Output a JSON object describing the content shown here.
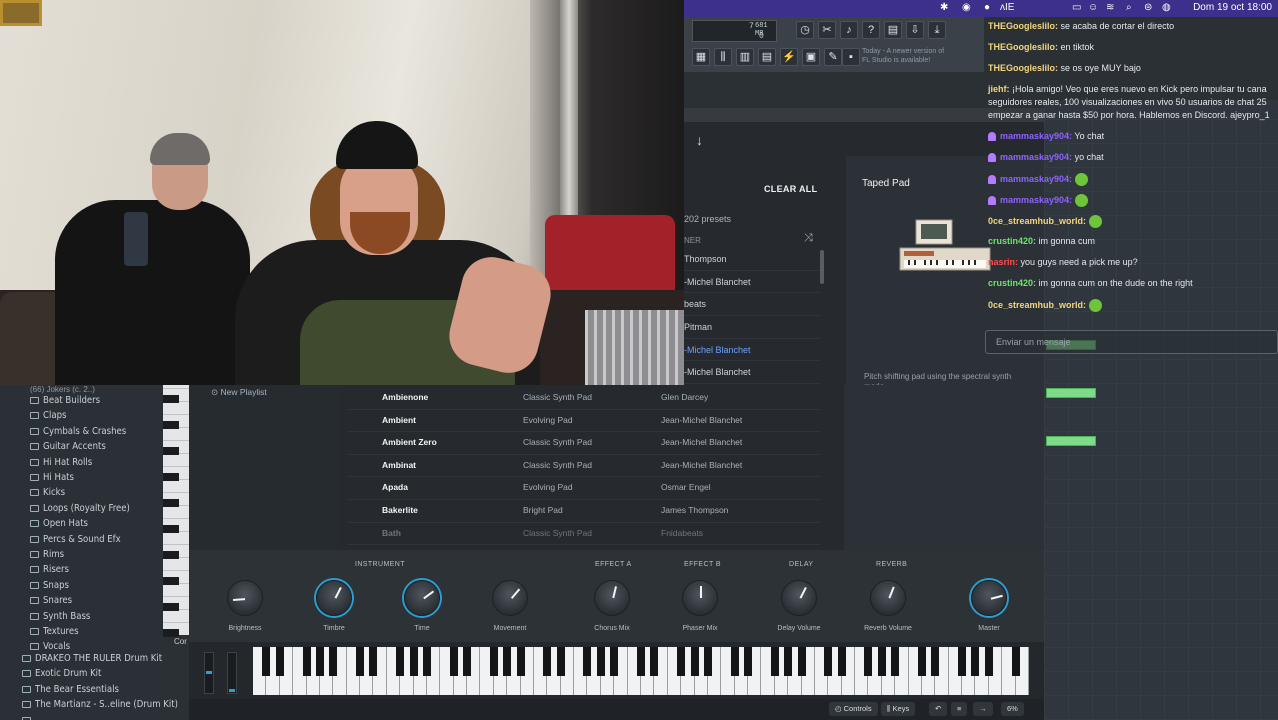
{
  "menubar": {
    "clock": "Dom 19 oct 18:00",
    "partial_label": "ʌIE"
  },
  "fl_toolbar": {
    "lcd_top": "7",
    "lcd_mem": "681 MB",
    "lcd_bottom": "0",
    "news": "Today - A newer version of FL Studio is available!"
  },
  "chat": {
    "messages": [
      {
        "user": "THEGoogleslilo:",
        "text": " se acaba de cortar el directo",
        "style": "user"
      },
      {
        "user": "THEGoogleslilo:",
        "text": " en tiktok",
        "style": "user"
      },
      {
        "user": "THEGoogleslilo:",
        "text": " se os oye MUY bajo",
        "style": "user"
      },
      {
        "user": "jiehf:",
        "text": " ¡Hola amigo! Veo que eres nuevo en Kick pero impulsar tu cana",
        "style": "user"
      },
      {
        "user": "",
        "text": "seguidores reales, 100 visualizaciones en vivo 50 usuarios de chat 25",
        "style": "user"
      },
      {
        "user": "",
        "text": "empezar a ganar hasta $50 por hora. Hablemos en Discord. ajeypro_1",
        "style": "user"
      },
      {
        "user": "mammaskay904:",
        "text": " Yo chat",
        "style": "purple"
      },
      {
        "user": "mammaskay904:",
        "text": " yo chat",
        "style": "purple"
      },
      {
        "user": "mammaskay904:",
        "text": " ",
        "style": "purple"
      },
      {
        "user": "mammaskay904:",
        "text": " ",
        "style": "purple"
      },
      {
        "user": "0ce_streamhub_world:",
        "text": " ",
        "style": "user"
      },
      {
        "user": "crustin420:",
        "text": " im gonna cum",
        "style": "green"
      },
      {
        "user": "nasrin:",
        "text": " you guys need a pick me up?",
        "style": "red"
      },
      {
        "user": "crustin420:",
        "text": " im gonna cum on the dude on the right",
        "style": "green"
      },
      {
        "user": "0ce_streamhub_world:",
        "text": " ",
        "style": "user"
      }
    ],
    "input_placeholder": "Enviar un mensaje"
  },
  "plugin": {
    "clear_all": "CLEAR ALL",
    "preset_count": "202 presets",
    "col_designer": "NER",
    "designers": [
      "Thompson",
      "-Michel Blanchet",
      "beats",
      "Pitman",
      "-Michel Blanchet",
      "-Michel Blanchet"
    ],
    "preset_title": "Taped Pad",
    "preset_desc": "Pitch shifting pad using the spectral synth mode."
  },
  "browser": {
    "truncated_top": "(66) Jokers   (c. 2..)",
    "items": [
      "Beat Builders",
      "Claps",
      "Cymbals & Crashes",
      "Guitar Accents",
      "Hi Hat Rolls",
      "Hi Hats",
      "Kicks",
      "Loops (Royalty Free)",
      "Open Hats",
      "Percs & Sound Efx",
      "Rims",
      "Risers",
      "Snaps",
      "Snares",
      "Synth Bass",
      "Textures",
      "Vocals"
    ],
    "top_items": [
      "DRAKEO THE RULER Drum Kit",
      "Exotic Drum Kit",
      "The Bear Essentials",
      "The Martianz - S..eline (Drum Kit)",
      "..."
    ],
    "cor_label": "Cor"
  },
  "playlist": {
    "new_playlist": "New Playlist"
  },
  "preset_table": [
    {
      "name": "Ambienone",
      "type": "Classic Synth Pad",
      "designer": "Glen Darcey"
    },
    {
      "name": "Ambient",
      "type": "Evolving Pad",
      "designer": "Jean-Michel Blanchet"
    },
    {
      "name": "Ambient Zero",
      "type": "Classic Synth Pad",
      "designer": "Jean-Michel Blanchet"
    },
    {
      "name": "Ambinat",
      "type": "Classic Synth Pad",
      "designer": "Jean-Michel Blanchet"
    },
    {
      "name": "Apada",
      "type": "Evolving Pad",
      "designer": "Osmar Engel"
    },
    {
      "name": "Bakerlite",
      "type": "Bright Pad",
      "designer": "James Thompson"
    },
    {
      "name": "Bath",
      "type": "Classic Synth Pad",
      "designer": "Fnidabeats"
    }
  ],
  "knob_sections": {
    "instrument": "INSTRUMENT",
    "effect_a": "EFFECT A",
    "effect_b": "EFFECT B",
    "delay": "DELAY",
    "reverb": "REVERB"
  },
  "knobs": [
    {
      "label": "Brightness",
      "value": 0.15,
      "accent": false
    },
    {
      "label": "Timbre",
      "value": 0.6,
      "accent": true
    },
    {
      "label": "Time",
      "value": 0.7,
      "accent": true
    },
    {
      "label": "Movement",
      "value": 0.65,
      "accent": false
    },
    {
      "label": "Chorus Mix",
      "value": 0.55,
      "accent": false
    },
    {
      "label": "Phaser Mix",
      "value": 0.5,
      "accent": false
    },
    {
      "label": "Delay Volume",
      "value": 0.6,
      "accent": false
    },
    {
      "label": "Reverb Volume",
      "value": 0.58,
      "accent": false
    },
    {
      "label": "Master",
      "value": 0.78,
      "accent": true
    }
  ],
  "statusbar": {
    "controls": "Controls",
    "keys": "Keys",
    "zoom": "6%"
  }
}
